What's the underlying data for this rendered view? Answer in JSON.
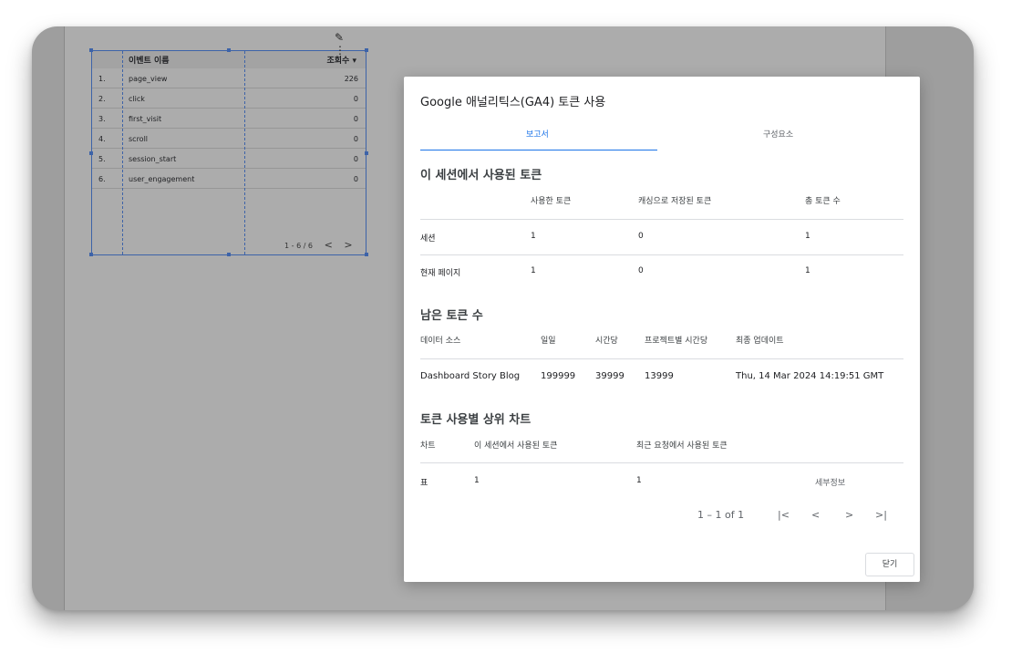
{
  "widget": {
    "toolbar": {
      "edit_icon": "✎",
      "menu_icon": "⋮"
    },
    "columns": {
      "event_name": "이벤트 이름",
      "views": "조회수 ▾"
    },
    "rows": [
      {
        "num": "1.",
        "name": "page_view",
        "value": "226"
      },
      {
        "num": "2.",
        "name": "click",
        "value": "0"
      },
      {
        "num": "3.",
        "name": "first_visit",
        "value": "0"
      },
      {
        "num": "4.",
        "name": "scroll",
        "value": "0"
      },
      {
        "num": "5.",
        "name": "session_start",
        "value": "0"
      },
      {
        "num": "6.",
        "name": "user_engagement",
        "value": "0"
      }
    ],
    "pager": {
      "range": "1 - 6 / 6",
      "prev": "<",
      "next": ">"
    }
  },
  "dialog": {
    "title": "Google 애널리틱스(GA4) 토큰 사용",
    "tabs": [
      "보고서",
      "구성요소"
    ],
    "sessions": {
      "heading": "이 세션에서 사용된 토큰",
      "headers": [
        "사용한 토큰",
        "캐싱으로 저장된 토큰",
        "총 토큰 수"
      ],
      "rows": [
        {
          "label": "세션",
          "used": "1",
          "cached": "0",
          "total": "1"
        },
        {
          "label": "현재 페이지",
          "used": "1",
          "cached": "0",
          "total": "1"
        }
      ]
    },
    "remaining": {
      "heading": "남은 토큰 수",
      "headers": [
        "데이터 소스",
        "일일",
        "시간당",
        "프로젝트별 시간당",
        "최종 업데이트"
      ],
      "row": {
        "source": "Dashboard Story Blog",
        "daily": "199999",
        "hourly": "39999",
        "project_hourly": "13999",
        "updated": "Thu, 14 Mar 2024 14:19:51 GMT"
      }
    },
    "top_charts": {
      "heading": "토큰 사용별 상위 차트",
      "headers": [
        "차트",
        "이 세션에서 사용된 토큰",
        "최근 요청에서 사용된 토큰"
      ],
      "row": {
        "chart": "표",
        "session": "1",
        "recent": "1",
        "details": "세부정보"
      }
    },
    "pagination": {
      "range": "1 – 1 of 1",
      "first": "|<",
      "prev": "<",
      "next": ">",
      "last": ">|"
    },
    "close_label": "닫기"
  }
}
